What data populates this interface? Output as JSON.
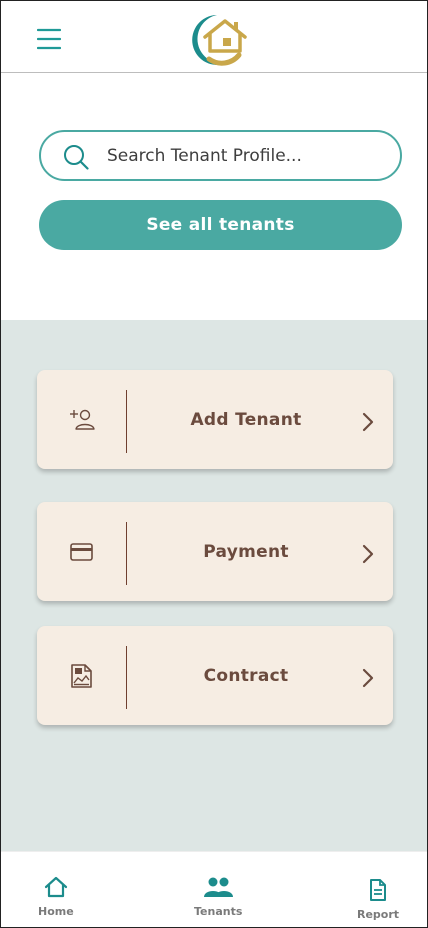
{
  "header": {
    "menu_icon": "hamburger-menu-icon",
    "logo_icon": "house-logo-icon"
  },
  "search": {
    "placeholder": "Search Tenant Profile...",
    "icon": "search-icon"
  },
  "see_all_button": {
    "label": "See all tenants"
  },
  "actions": [
    {
      "label": "Add Tenant",
      "icon": "add-user-icon"
    },
    {
      "label": "Payment",
      "icon": "credit-card-icon"
    },
    {
      "label": "Contract",
      "icon": "contract-document-icon"
    }
  ],
  "bottom_nav": [
    {
      "label": "Home",
      "icon": "home-icon"
    },
    {
      "label": "Tenants",
      "icon": "tenants-group-icon"
    },
    {
      "label": "Report",
      "icon": "report-document-icon"
    }
  ],
  "colors": {
    "teal": "#4aa9a2",
    "panel_bg": "#dde6e4",
    "card_bg": "#f6ede3",
    "brown_text": "#6b4b3e",
    "logo_gold": "#c9a74a"
  }
}
